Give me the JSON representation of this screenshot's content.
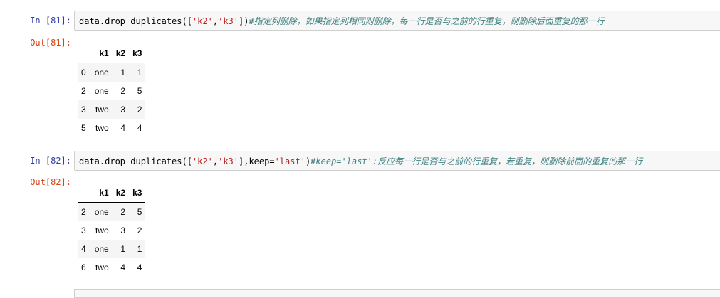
{
  "cells": [
    {
      "in_prompt": "In  [81]:",
      "out_prompt": "Out[81]:",
      "code": {
        "prefix": "data.drop_duplicates([",
        "s1": "'k2'",
        "comma": ",",
        "s2": "'k3'",
        "mid": "",
        "kwarg": "",
        "kwval": "",
        "close": "])",
        "comment": "#指定列删除，如果指定列相同则删除，每一行是否与之前的行重复，则删除后面重复的那一行"
      },
      "columns": [
        "",
        "k1",
        "k2",
        "k3"
      ],
      "rows": [
        [
          "0",
          "one",
          "1",
          "1"
        ],
        [
          "2",
          "one",
          "2",
          "5"
        ],
        [
          "3",
          "two",
          "3",
          "2"
        ],
        [
          "5",
          "two",
          "4",
          "4"
        ]
      ]
    },
    {
      "in_prompt": "In  [82]:",
      "out_prompt": "Out[82]:",
      "code": {
        "prefix": "data.drop_duplicates([",
        "s1": "'k2'",
        "comma": ",",
        "s2": "'k3'",
        "mid": "],keep=",
        "kwarg": "'last'",
        "kwval": "",
        "close": ")",
        "comment": "#keep='last':反应每一行是否与之前的行重复，若重复，则删除前面的重复的那一行"
      },
      "columns": [
        "",
        "k1",
        "k2",
        "k3"
      ],
      "rows": [
        [
          "2",
          "one",
          "2",
          "5"
        ],
        [
          "3",
          "two",
          "3",
          "2"
        ],
        [
          "4",
          "one",
          "1",
          "1"
        ],
        [
          "6",
          "two",
          "4",
          "4"
        ]
      ]
    }
  ]
}
